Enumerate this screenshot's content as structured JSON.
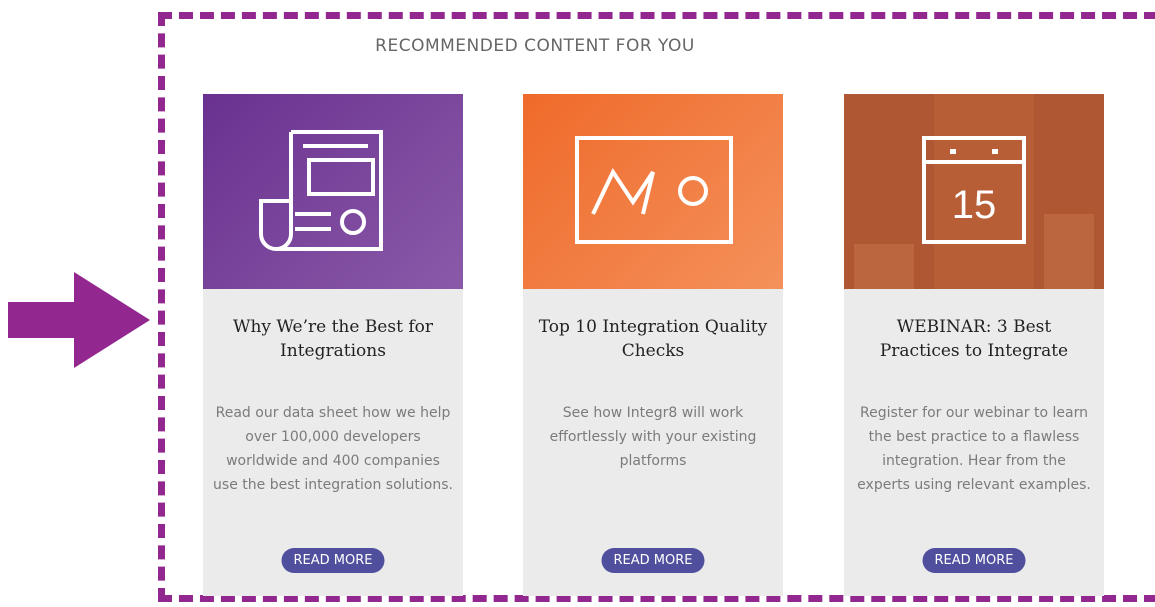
{
  "section_title": "RECOMMENDED CONTENT FOR YOU",
  "colors": {
    "frame": "#92278f",
    "arrow": "#92278f",
    "card_bg": "#ebebeb",
    "button": "#4f4f9e"
  },
  "cards": [
    {
      "icon": "document-icon",
      "title": "Why We’re the Best for Integrations",
      "description": "Read our data sheet how we help over 100,000 developers worldwide and 400 companies use the best integration solutions.",
      "button": "READ MORE"
    },
    {
      "icon": "presentation-icon",
      "title": "Top 10 Integration Quality Checks",
      "description": "See how Integr8 will work effortlessly with your existing platforms",
      "button": "READ MORE"
    },
    {
      "icon": "calendar-icon",
      "calendar_day": "15",
      "title": "WEBINAR: 3 Best Practices to Integrate",
      "description": "Register for our webinar to learn the best practice to a flawless integration. Hear from the experts using relevant examples.",
      "button": "READ MORE"
    }
  ]
}
